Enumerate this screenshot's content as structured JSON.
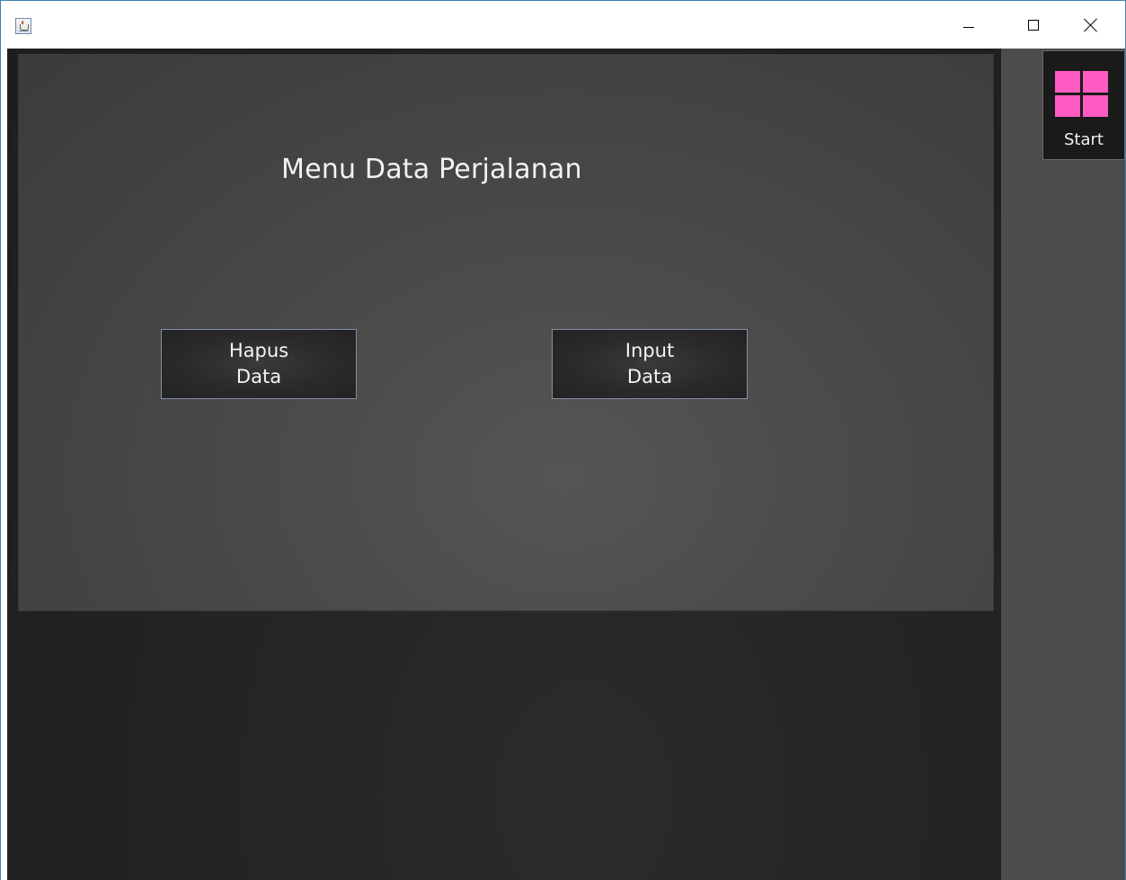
{
  "window": {
    "controls": {
      "minimize": "minimize",
      "maximize": "maximize",
      "close": "close"
    }
  },
  "main": {
    "title": "Menu Data Perjalanan",
    "buttons": {
      "hapus": [
        "Hapus",
        "Data"
      ],
      "input": [
        "Input",
        "Data"
      ]
    }
  },
  "side": {
    "start_label": "Start",
    "start_icon": "windows-logo-icon",
    "accent_color": "#ff5bc3"
  },
  "colors": {
    "panel_background": "#4b4948",
    "dark_background": "#222222",
    "button_border": "#7f8fa6",
    "text": "#f2f2f2"
  }
}
